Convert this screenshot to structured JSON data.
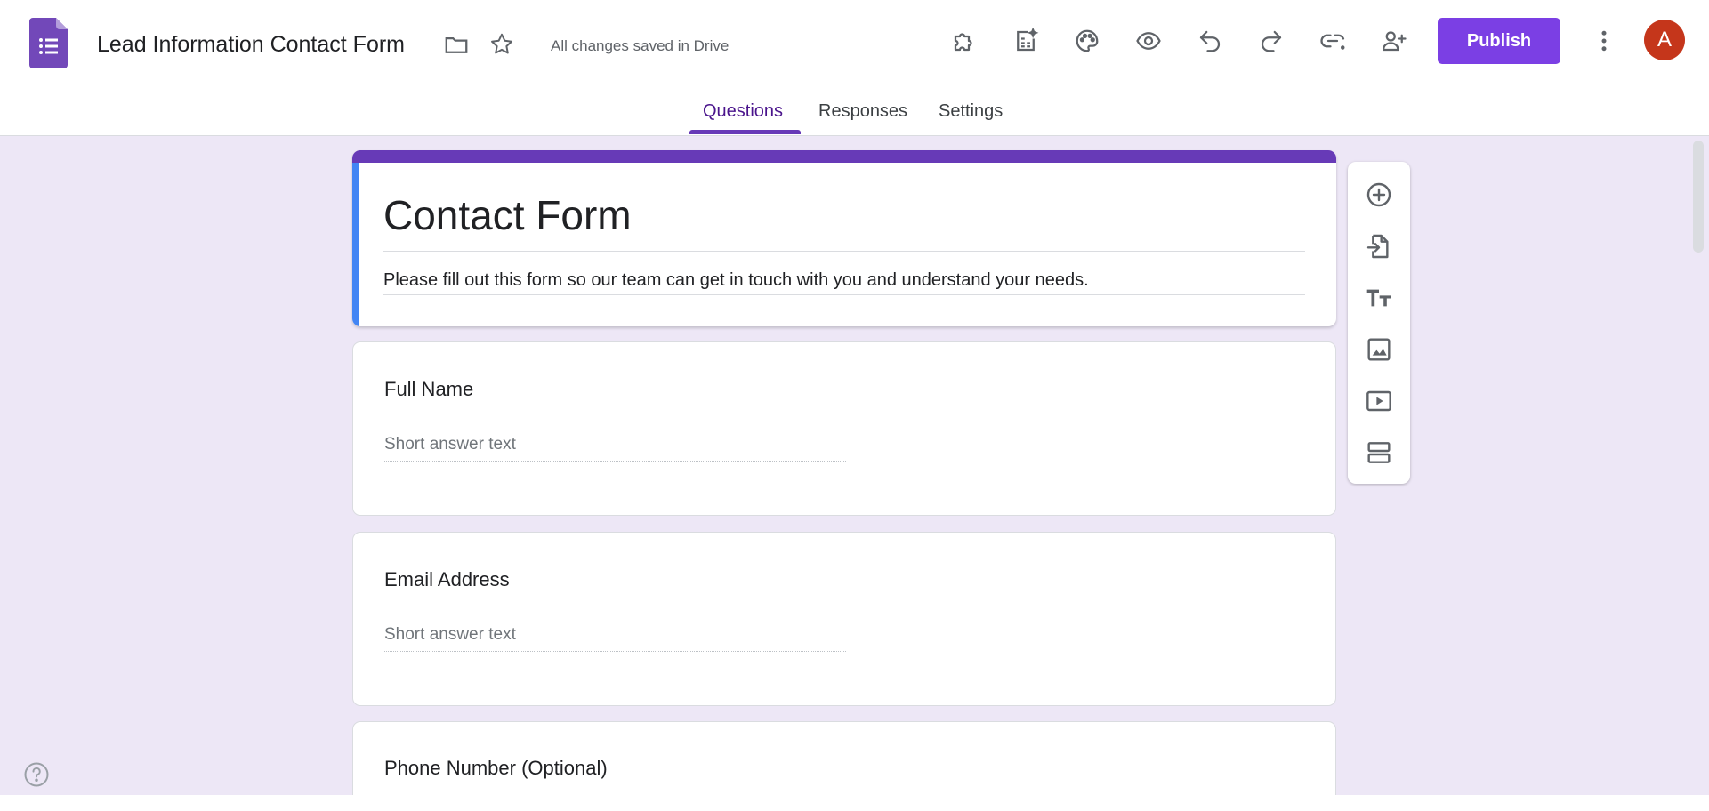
{
  "app": {
    "doc_title": "Lead Information Contact Form",
    "saved_status": "All changes saved in Drive",
    "avatar_letter": "A"
  },
  "toolbar": {
    "publish_label": "Publish",
    "icons": [
      "add-ons-icon",
      "customize-with-ai-icon",
      "palette-icon",
      "preview-icon",
      "undo-icon",
      "redo-icon",
      "copy-link-icon",
      "add-collaborators-icon",
      "more-vert-icon"
    ]
  },
  "tabs": [
    {
      "label": "Questions",
      "active": true
    },
    {
      "label": "Responses",
      "active": false
    },
    {
      "label": "Settings",
      "active": false
    }
  ],
  "form": {
    "title": "Contact Form",
    "description": "Please fill out this form so our team can get in touch with you and understand your needs."
  },
  "questions": [
    {
      "title": "Full Name",
      "placeholder": "Short answer text"
    },
    {
      "title": "Email Address",
      "placeholder": "Short answer text"
    },
    {
      "title": "Phone Number (Optional)",
      "placeholder": ""
    }
  ],
  "side_toolbar": {
    "items": [
      "add-question-icon",
      "import-questions-icon",
      "add-title-icon",
      "add-image-icon",
      "add-video-icon",
      "add-section-icon"
    ]
  },
  "colors": {
    "accent": "#673ab7",
    "publish": "#7b3fe4",
    "background": "#ede7f6",
    "title_left_bar": "#4285f4",
    "avatar": "#c5361b"
  }
}
